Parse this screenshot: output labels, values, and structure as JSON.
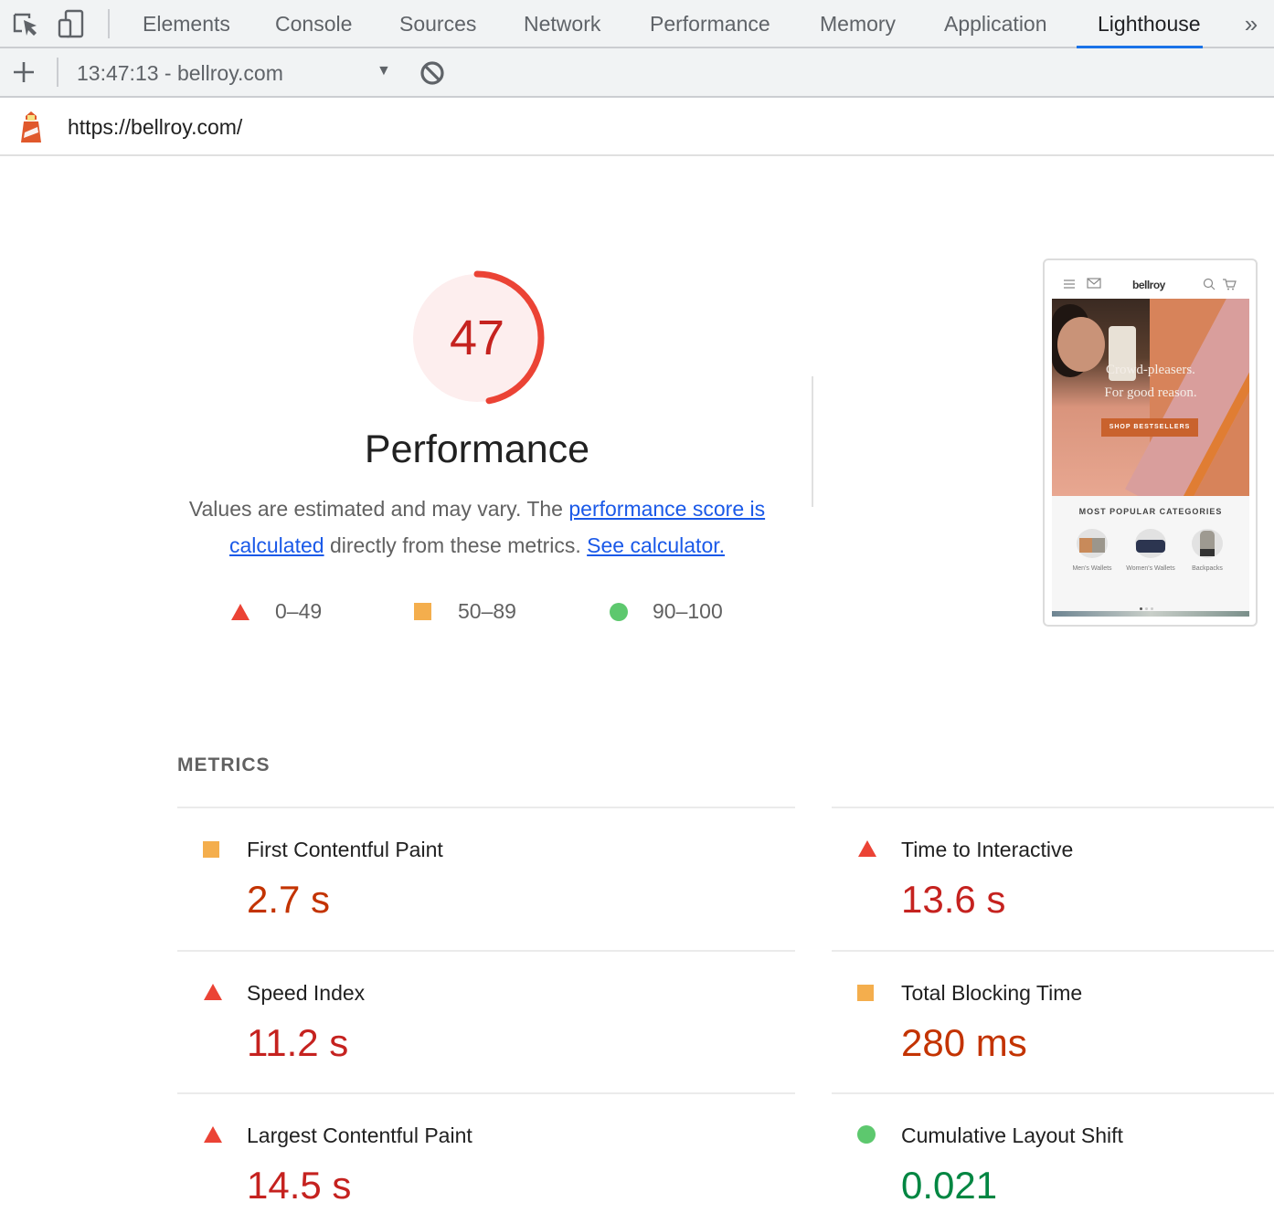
{
  "devtools": {
    "tabs": [
      {
        "label": "Elements",
        "active": false
      },
      {
        "label": "Console",
        "active": false
      },
      {
        "label": "Sources",
        "active": false
      },
      {
        "label": "Network",
        "active": false
      },
      {
        "label": "Performance",
        "active": false
      },
      {
        "label": "Memory",
        "active": false
      },
      {
        "label": "Application",
        "active": false
      },
      {
        "label": "Lighthouse",
        "active": true
      }
    ],
    "more_tabs_glyph": "»",
    "icons": {
      "inspect": "inspect-element-icon",
      "device": "device-toolbar-icon",
      "more": "chevron-double-right-icon"
    }
  },
  "toolbar": {
    "report_selector": "13:47:13 - bellroy.com",
    "new_report_icon": "plus-icon",
    "clear_icon": "block-icon",
    "caret": "▼"
  },
  "urlbar": {
    "url": "https://bellroy.com/",
    "icon": "lighthouse-icon"
  },
  "score": {
    "value": "47",
    "fraction": 0.47,
    "category": "Performance",
    "color": "#c5221f",
    "arc_color": "#eb4335",
    "bg_color": "#fdeeee"
  },
  "description": {
    "text1": "Values are estimated and may vary. The ",
    "link1": "performance score is calculated",
    "text2": " directly from these metrics. ",
    "link2": "See calculator."
  },
  "legend": [
    {
      "shape": "triangle",
      "range": "0–49",
      "color": "#eb4335"
    },
    {
      "shape": "square",
      "range": "50–89",
      "color": "#f4ae4d"
    },
    {
      "shape": "circle",
      "range": "90–100",
      "color": "#5dc86e"
    }
  ],
  "screenshot": {
    "brand": "bellroy",
    "headline_line1": "Crowd-pleasers.",
    "headline_line2": "For good reason.",
    "cta": "SHOP BESTSELLERS",
    "section_title": "MOST POPULAR CATEGORIES",
    "categories": [
      "Men's Wallets",
      "Women's Wallets",
      "Backpacks"
    ]
  },
  "metrics": {
    "title": "METRICS",
    "items": [
      {
        "label": "First Contentful Paint",
        "value": "2.7 s",
        "rating": "average"
      },
      {
        "label": "Time to Interactive",
        "value": "13.6 s",
        "rating": "fail"
      },
      {
        "label": "Speed Index",
        "value": "11.2 s",
        "rating": "fail"
      },
      {
        "label": "Total Blocking Time",
        "value": "280 ms",
        "rating": "average"
      },
      {
        "label": "Largest Contentful Paint",
        "value": "14.5 s",
        "rating": "fail"
      },
      {
        "label": "Cumulative Layout Shift",
        "value": "0.021",
        "rating": "pass"
      }
    ]
  }
}
